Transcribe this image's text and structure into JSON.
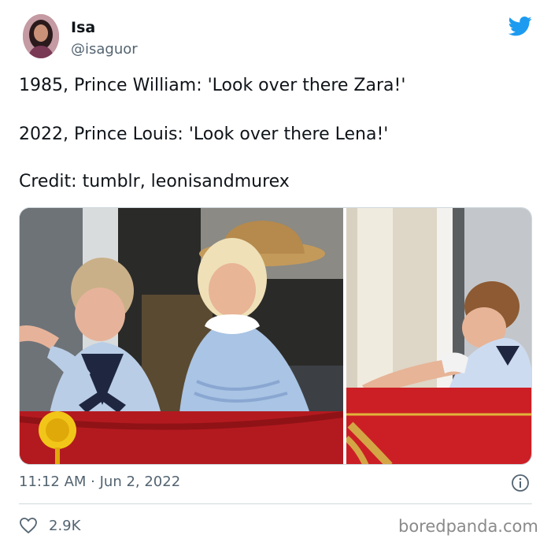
{
  "user": {
    "name": "Isa",
    "handle": "@isaguor"
  },
  "tweet": {
    "lines": [
      "1985, Prince William: 'Look over there Zara!'",
      "2022, Prince Louis: 'Look over there Lena!'",
      "Credit: tumblr, leonisandmurex"
    ]
  },
  "media": {
    "photo_left": "royal-balcony-1985-photo",
    "photo_right": "royal-balcony-2022-photo"
  },
  "meta": {
    "timestamp": "11:12 AM · Jun 2, 2022"
  },
  "engagement": {
    "likes": "2.9K"
  },
  "watermark": "boredpanda.com",
  "colors": {
    "twitter_blue": "#1d9bf0",
    "text": "#0f1419",
    "secondary_text": "#536471",
    "divider": "#cfd9de"
  },
  "icons": [
    "twitter-bird-icon",
    "info-icon",
    "heart-icon"
  ]
}
